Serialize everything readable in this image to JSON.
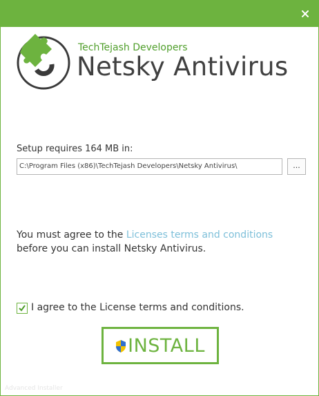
{
  "window": {
    "accent_color": "#6db33f",
    "close_icon": "close-icon"
  },
  "header": {
    "company": "TechTejash Developers",
    "product": "Netsky Antivirus",
    "logo_icon": "puzzle-logo-icon"
  },
  "setup": {
    "label": "Setup requires 164 MB in:",
    "path": "C:\\Program Files (x86)\\TechTejash Developers\\Netsky Antivirus\\",
    "browse_label": "..."
  },
  "license": {
    "text_before": "You must agree to the ",
    "link_text": "Licenses terms and conditions",
    "text_after": " before you can install Netsky Antivirus.",
    "link_color": "#7dbfd9"
  },
  "agreement": {
    "checked": true,
    "label": "I agree to the License terms and conditions."
  },
  "install": {
    "label": "INSTALL",
    "icon": "uac-shield-icon"
  },
  "footer": {
    "text": "Advanced Installer"
  }
}
